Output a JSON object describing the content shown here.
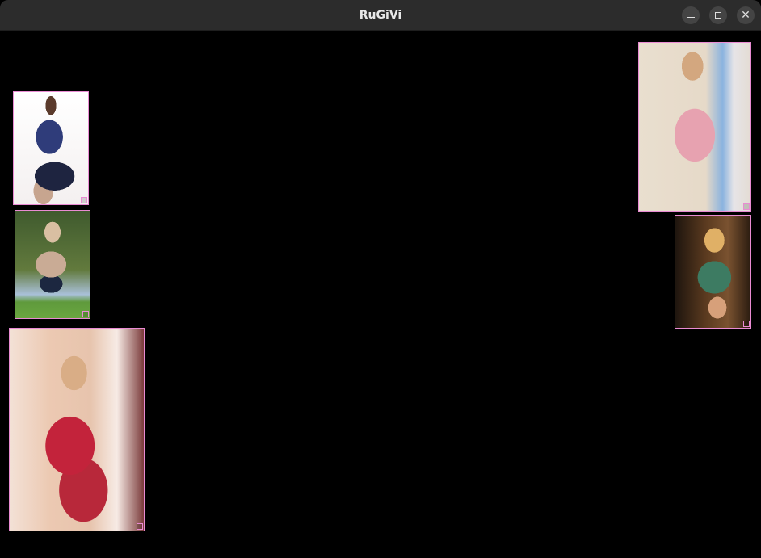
{
  "window": {
    "title": "RuGiVi",
    "controls": {
      "minimize": "",
      "maximize": "",
      "close": "✕"
    }
  },
  "canvas": {
    "background": "#000000",
    "frame_color": "#e98bd3",
    "tiles": [
      {
        "name": "image-tile-1",
        "icon": "photo-thumbnail"
      },
      {
        "name": "image-tile-2",
        "icon": "photo-thumbnail"
      },
      {
        "name": "image-tile-3",
        "icon": "photo-thumbnail"
      },
      {
        "name": "image-tile-4",
        "icon": "photo-thumbnail"
      },
      {
        "name": "image-tile-5",
        "icon": "photo-thumbnail"
      }
    ]
  }
}
